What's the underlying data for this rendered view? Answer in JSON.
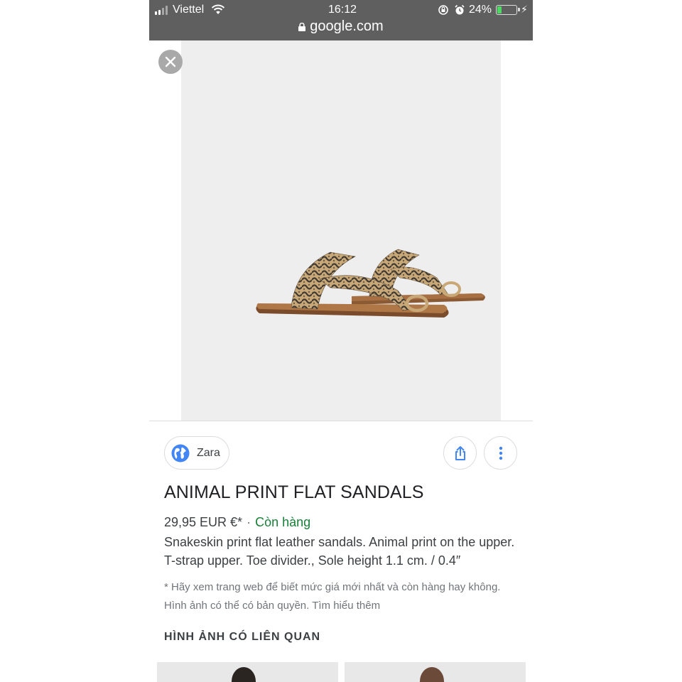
{
  "status_bar": {
    "carrier": "Viettel",
    "time": "16:12",
    "battery_percent": "24%",
    "battery_level": 0.24,
    "icons": [
      "signal-icon",
      "wifi-icon",
      "rotation-lock-icon",
      "alarm-icon",
      "battery-icon",
      "charging-icon"
    ]
  },
  "url_bar": {
    "domain": "google.com",
    "icon": "padlock-icon"
  },
  "image_viewer": {
    "close_icon": "close-icon",
    "background_color": "#eeeeee"
  },
  "source": {
    "name": "Zara",
    "icon": "globe-icon"
  },
  "actions": {
    "share_icon": "share-icon",
    "more_icon": "more-vertical-icon"
  },
  "product": {
    "title": "ANIMAL PRINT FLAT SANDALS",
    "price": "29,95 EUR €*",
    "separator": "·",
    "availability": "Còn hàng",
    "description": "Snakeskin print flat leather sandals. Animal print on the upper. T-strap upper. Toe divider., Sole height 1.1 cm. / 0.4″",
    "note": "* Hãy xem trang web để biết mức giá mới nhất và còn hàng hay không. Hình ảnh có thể có bản quyền. Tìm hiểu thêm"
  },
  "related": {
    "heading": "HÌNH ẢNH CÓ LIÊN QUAN"
  },
  "colors": {
    "availability": "#188038",
    "accent_blue": "#4285f4",
    "top_bar": "#5f5f5f"
  }
}
